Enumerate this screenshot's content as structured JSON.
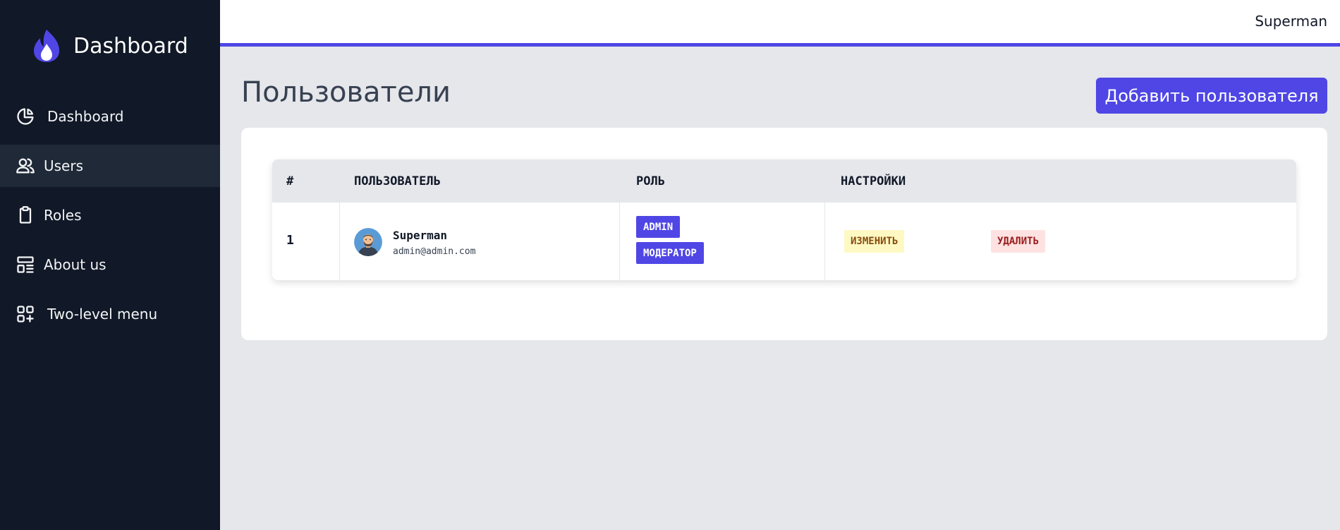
{
  "brand": {
    "title": "Dashboard",
    "logo_icon": "flame-icon",
    "accent": "#4f46e5"
  },
  "sidebar": {
    "items": [
      {
        "label": "Dashboard",
        "icon": "pie-chart-icon",
        "active": false
      },
      {
        "label": "Users",
        "icon": "users-icon",
        "active": true
      },
      {
        "label": "Roles",
        "icon": "clipboard-icon",
        "active": false
      },
      {
        "label": "About us",
        "icon": "layout-icon",
        "active": false
      },
      {
        "label": "Two-level menu",
        "icon": "grid-plus-icon",
        "active": false
      }
    ]
  },
  "topbar": {
    "user": "Superman"
  },
  "main": {
    "title": "Пользователи",
    "add_button": "Добавить пользователя",
    "table": {
      "headers": [
        "#",
        "ПОЛЬЗОВАТЕЛЬ",
        "РОЛЬ",
        "НАСТРОЙКИ"
      ],
      "rows": [
        {
          "num": "1",
          "name": "Superman",
          "email": "admin@admin.com",
          "roles": [
            "ADMIN",
            "МОДЕРАТОР"
          ],
          "edit": "ИЗМЕНИТЬ",
          "delete": "УДАЛИТЬ"
        }
      ]
    }
  }
}
